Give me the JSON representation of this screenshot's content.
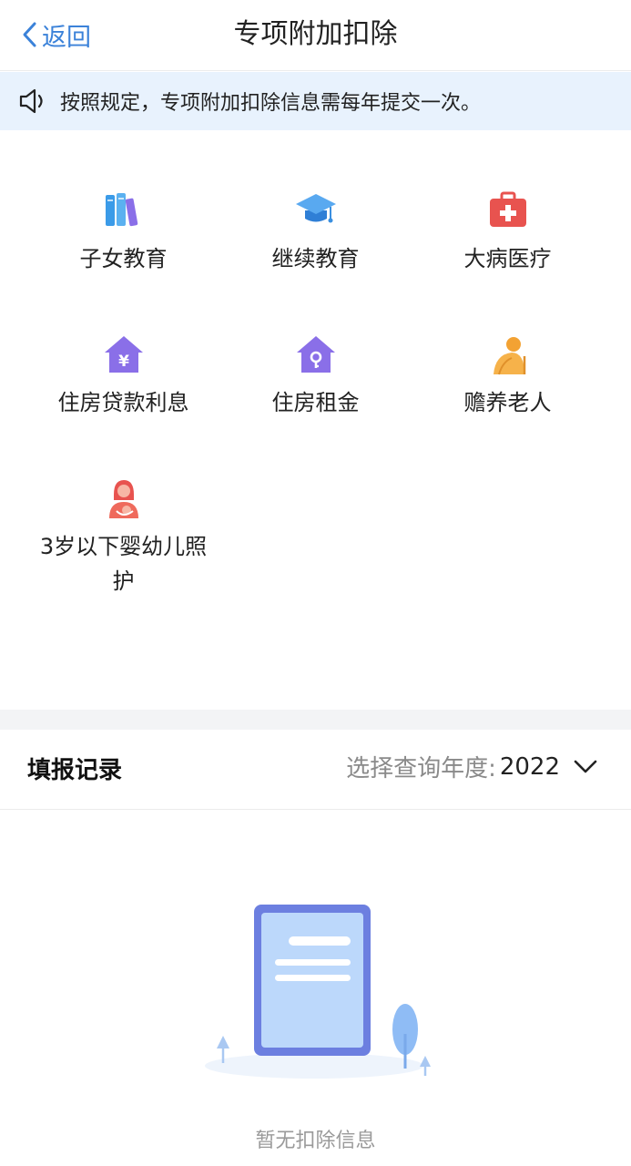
{
  "header": {
    "back_label": "返回",
    "title": "专项附加扣除"
  },
  "notice": {
    "text": "按照规定，专项附加扣除信息需每年提交一次。"
  },
  "categories": [
    {
      "label": "子女教育",
      "icon": "books-icon"
    },
    {
      "label": "继续教育",
      "icon": "graduation-cap-icon"
    },
    {
      "label": "大病医疗",
      "icon": "medical-kit-icon"
    },
    {
      "label": "住房贷款利息",
      "icon": "house-yuan-icon"
    },
    {
      "label": "住房租金",
      "icon": "house-key-icon"
    },
    {
      "label": "赡养老人",
      "icon": "elderly-person-icon"
    },
    {
      "label": "3岁以下婴幼儿照护",
      "icon": "mother-baby-icon"
    }
  ],
  "records": {
    "title": "填报记录",
    "year_prompt": "选择查询年度:",
    "year_value": "2022",
    "empty_text": "暂无扣除信息"
  },
  "colors": {
    "accent": "#3b82d9",
    "notice_bg": "#e8f2fd",
    "purple": "#8a6fe8",
    "red": "#e8534f",
    "orange": "#f3a233"
  }
}
